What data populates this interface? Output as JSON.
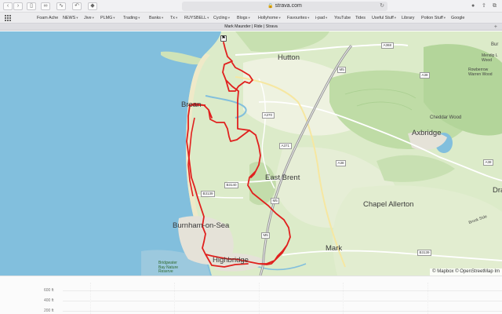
{
  "browser": {
    "address": "strava.com",
    "tab_title": "Mark Maunder | Ride | Strava"
  },
  "bookmarks": [
    {
      "label": "Foam Ache",
      "chevron": false
    },
    {
      "label": "NEWS",
      "chevron": true
    },
    {
      "label": "Jive",
      "chevron": true
    },
    {
      "label": "PLMG",
      "chevron": true
    },
    {
      "label": "Trading",
      "chevron": true
    },
    {
      "label": "Banks",
      "chevron": true
    },
    {
      "label": "Tx",
      "chevron": true
    },
    {
      "label": "RUYSBELL",
      "chevron": true
    },
    {
      "label": "Cycling",
      "chevron": true
    },
    {
      "label": "Blogs",
      "chevron": true
    },
    {
      "label": "Hollyhome",
      "chevron": true
    },
    {
      "label": "Favourites",
      "chevron": true
    },
    {
      "label": "i-pad",
      "chevron": true
    },
    {
      "label": "YouTube",
      "chevron": false
    },
    {
      "label": "Tides",
      "chevron": false
    },
    {
      "label": "Useful Stuff",
      "chevron": true
    },
    {
      "label": "Library",
      "chevron": false
    },
    {
      "label": "Potion Stuff",
      "chevron": true
    },
    {
      "label": "Google",
      "chevron": false
    }
  ],
  "map": {
    "towns": {
      "hutton": "Hutton",
      "brean": "Brean",
      "east_brent": "East Brent",
      "axbridge": "Axbridge",
      "chapel_allerton": "Chapel Allerton",
      "burnham": "Burnham-on-Sea",
      "highbridge": "Highbridge",
      "mark": "Mark"
    },
    "places": {
      "cheddar_wood": "Cheddar Wood",
      "rowberrow": "Rowberrow\nWarren Wood",
      "mendip": "Mendip L\nWood",
      "brook_side": "Brook Side",
      "bur": "Bur",
      "dra": "Dra",
      "nature_reserve": "Bridgwater\nBay Nature\nReserve"
    },
    "roads": [
      "A368",
      "M5",
      "A38",
      "A370",
      "A371",
      "A38",
      "B3140",
      "B3139",
      "M5",
      "B3139",
      "M5",
      "A38"
    ],
    "attribution": "© Mapbox © OpenStreetMap Im",
    "colors": {
      "sea": "#82bfdd",
      "land": "#dcebc9",
      "route": "#e0201e"
    }
  },
  "elevation": {
    "labels": [
      "600 ft",
      "400 ft",
      "200 ft"
    ]
  }
}
